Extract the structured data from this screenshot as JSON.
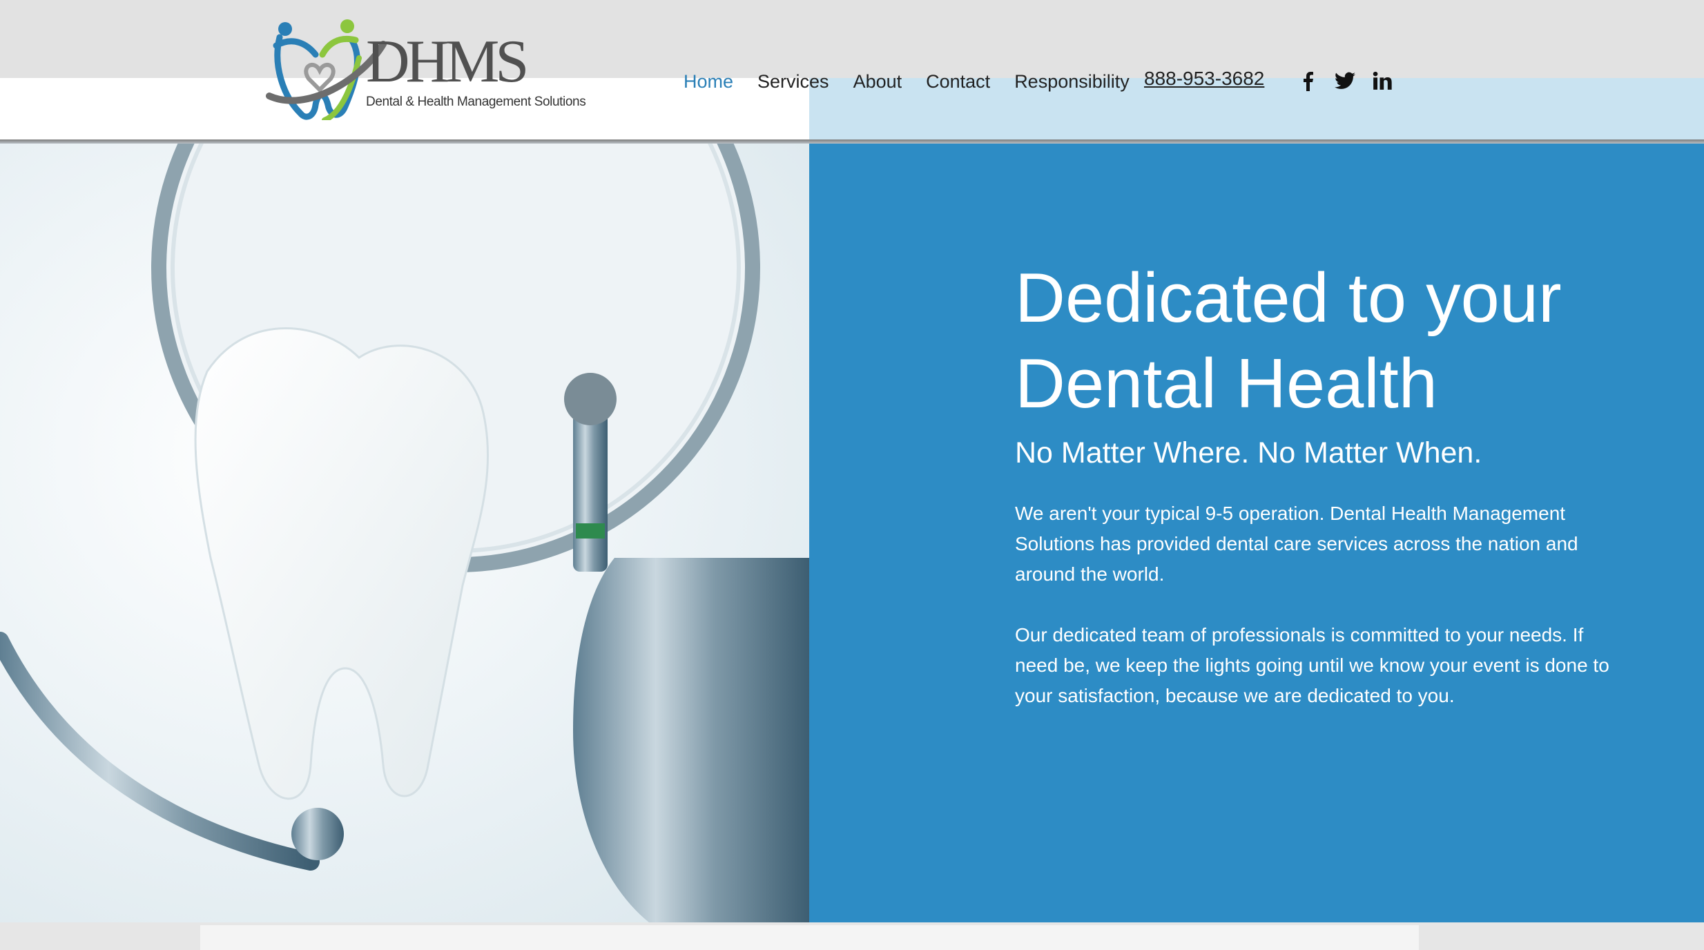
{
  "brand": {
    "logo_text": "DHMS",
    "logo_subtitle": "Dental & Health Management Solutions",
    "colors": {
      "blue": "#2a7fb6",
      "green": "#8cc63e",
      "gray": "#6d6d6d"
    }
  },
  "nav": {
    "items": [
      {
        "label": "Home",
        "active": true
      },
      {
        "label": "Services",
        "active": false
      },
      {
        "label": "About",
        "active": false
      },
      {
        "label": "Contact",
        "active": false
      },
      {
        "label": "Responsibility",
        "active": false
      }
    ],
    "phone": "888-953-3682"
  },
  "social": [
    {
      "name": "facebook-icon"
    },
    {
      "name": "twitter-icon"
    },
    {
      "name": "linkedin-icon"
    }
  ],
  "hero": {
    "headline_line1": "Dedicated to your",
    "headline_line2": "Dental Health",
    "subheadline": "No Matter Where. No Matter When.",
    "paragraph1": "We aren't your typical 9-5 operation. Dental Health Management Solutions has provided dental care services across the nation and around the world.",
    "paragraph2": "Our dedicated team of professionals is committed to your needs. If need be, we keep the lights going until we know your event is done to your satisfaction, because we are dedicated to you.",
    "panel_color": "#2d8cc5"
  }
}
